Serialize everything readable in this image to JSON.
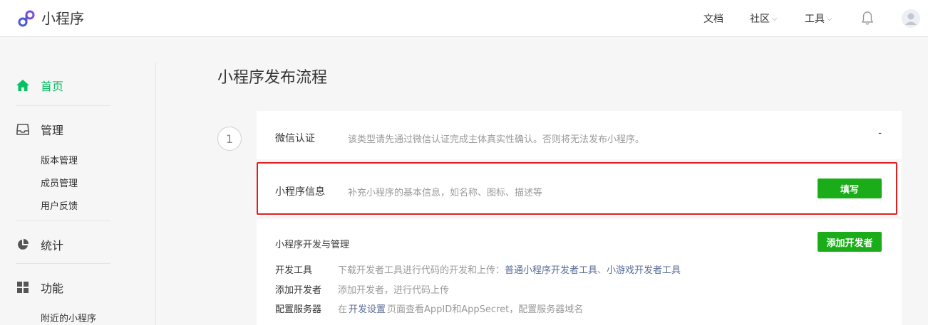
{
  "header": {
    "app_name": "小程序",
    "nav": [
      {
        "label": "文档",
        "has_dropdown": false
      },
      {
        "label": "社区",
        "has_dropdown": true
      },
      {
        "label": "工具",
        "has_dropdown": true
      }
    ]
  },
  "sidebar": {
    "groups": [
      {
        "label": "首页",
        "icon": "home-icon",
        "active": true
      },
      {
        "label": "管理",
        "icon": "inbox-icon",
        "active": false,
        "children": [
          "版本管理",
          "成员管理",
          "用户反馈"
        ]
      },
      {
        "label": "统计",
        "icon": "pie-chart-icon",
        "active": false
      },
      {
        "label": "功能",
        "icon": "grid-icon",
        "active": false,
        "children": [
          "附近的小程序"
        ]
      }
    ]
  },
  "main": {
    "title": "小程序发布流程",
    "step_number": "1",
    "steps": [
      {
        "label": "微信认证",
        "description": "该类型请先通过微信认证完成主体真实性确认。否则将无法发布小程序。",
        "status": "-"
      },
      {
        "label": "小程序信息",
        "description": "补充小程序的基本信息，如名称、图标、描述等",
        "action": "填写"
      }
    ],
    "dev_section": {
      "title": "小程序开发与管理",
      "action": "添加开发者",
      "rows": [
        {
          "key": "开发工具",
          "text": "下载开发者工具进行代码的开发和上传：",
          "link1": "普通小程序开发者工具",
          "sep": "、",
          "link2": "小游戏开发者工具"
        },
        {
          "key": "添加开发者",
          "text": "添加开发者，进行代码上传"
        },
        {
          "key": "配置服务器",
          "prefix": "在",
          "link": "开发设置",
          "suffix": "页面查看AppID和AppSecret，配置服务器域名"
        }
      ]
    }
  },
  "colors": {
    "brand_green": "#1aad19",
    "active_green": "#07c160",
    "highlight_red": "#e02020",
    "link_blue": "#576b95"
  }
}
